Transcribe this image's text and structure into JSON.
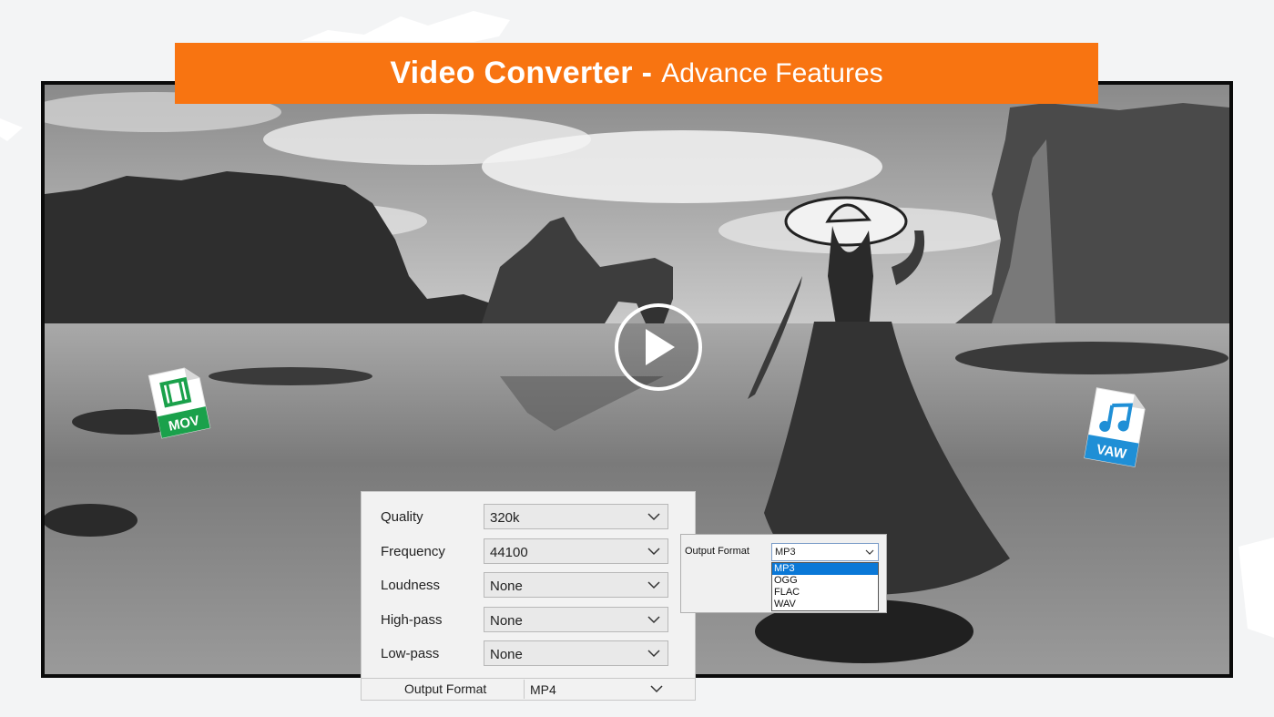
{
  "banner": {
    "title": "Video Converter -",
    "subtitle": "Advance Features"
  },
  "colors": {
    "accent": "#f87411",
    "mov_badge": "#1aa14b",
    "wav_badge": "#1f8fd6"
  },
  "icons": {
    "mov": "MOV",
    "wav": "VAW",
    "play": "play-icon"
  },
  "settings": [
    {
      "label": "Quality",
      "value": "320k"
    },
    {
      "label": "Frequency",
      "value": "44100"
    },
    {
      "label": "Loudness",
      "value": "None"
    },
    {
      "label": "High-pass",
      "value": "None"
    },
    {
      "label": "Low-pass",
      "value": "None"
    }
  ],
  "bottom": {
    "label": "Output Format",
    "value": "MP4"
  },
  "popup": {
    "label": "Output Format",
    "value": "MP3",
    "options": [
      "MP3",
      "OGG",
      "FLAC",
      "WAV"
    ],
    "selected_index": 0
  }
}
